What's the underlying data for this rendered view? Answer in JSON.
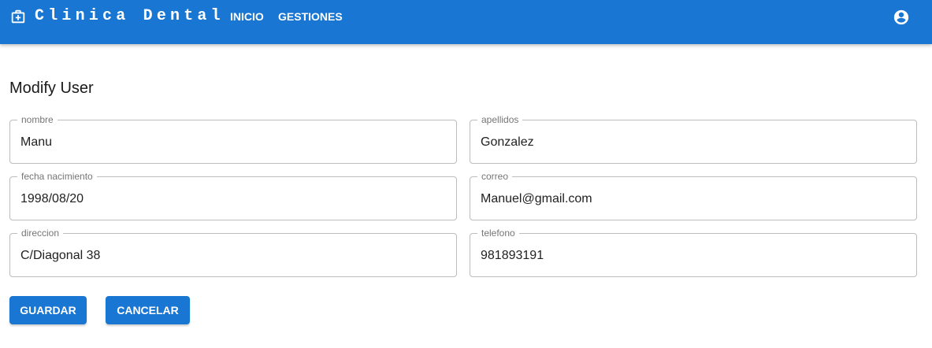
{
  "header": {
    "brand_icon": "medical-bag-icon",
    "title": "Clinica Dental",
    "nav": [
      {
        "label": "INICIO"
      },
      {
        "label": "GESTIONES"
      }
    ],
    "account_icon": "account-circle-icon",
    "color": "#1976d2"
  },
  "form": {
    "title": "Modify User",
    "fields": {
      "nombre": {
        "label": "nombre",
        "value": "Manu"
      },
      "apellidos": {
        "label": "apellidos",
        "value": "Gonzalez"
      },
      "fecha_nacimiento": {
        "label": "fecha nacimiento",
        "value": "1998/08/20"
      },
      "correo": {
        "label": "correo",
        "value": "Manuel@gmail.com"
      },
      "direccion": {
        "label": "direccion",
        "value": "C/Diagonal 38"
      },
      "telefono": {
        "label": "telefono",
        "value": "981893191"
      }
    },
    "buttons": {
      "save": "GUARDAR",
      "cancel": "CANCELAR"
    }
  }
}
